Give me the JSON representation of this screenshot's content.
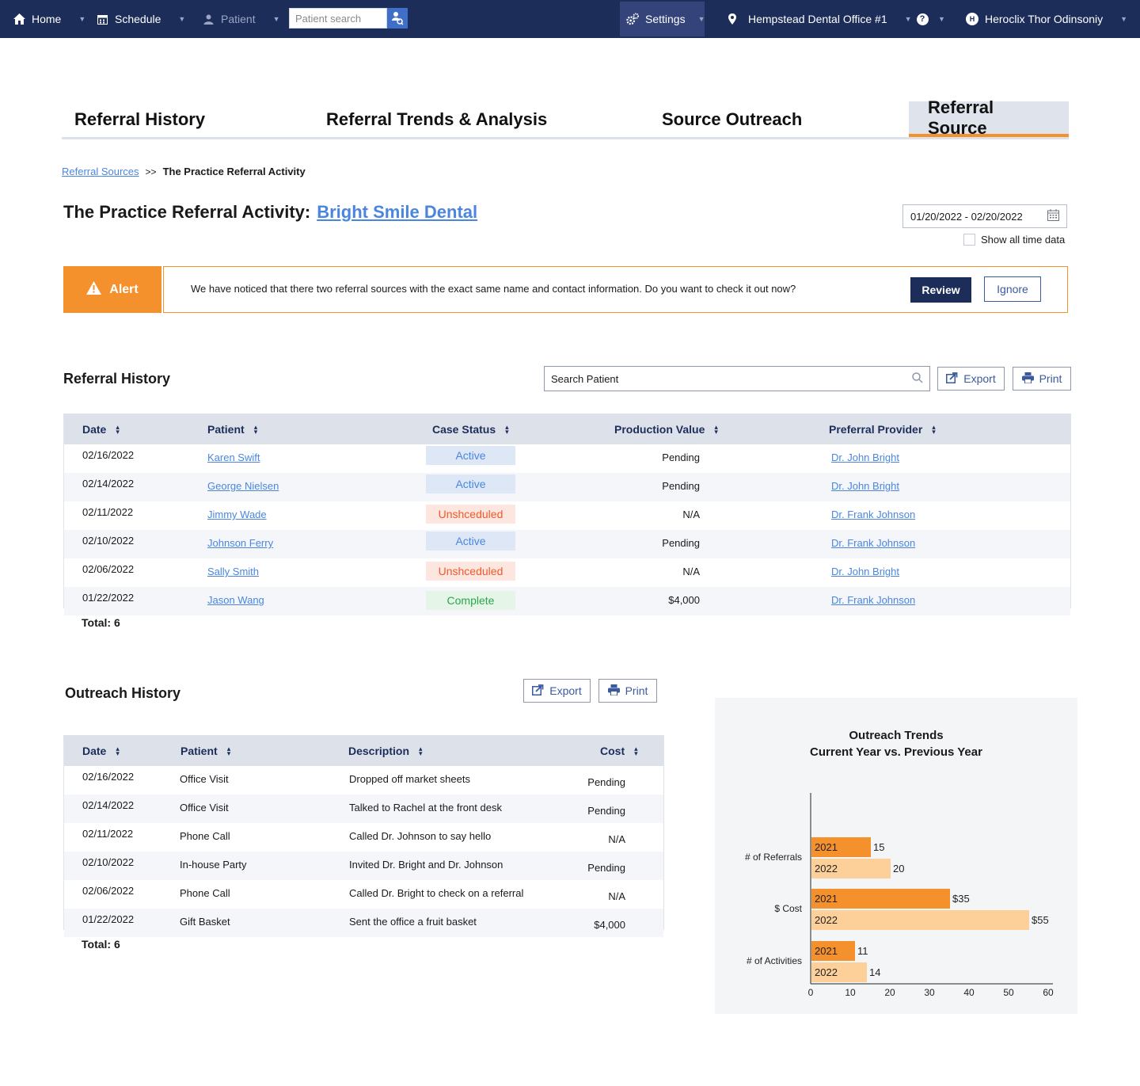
{
  "nav": {
    "home": "Home",
    "schedule": "Schedule",
    "patient": "Patient",
    "patient_search_placeholder": "Patient search",
    "settings": "Settings",
    "office": "Hempstead Dental Office #1",
    "help": "?",
    "avatar_initials": "H",
    "user": "Heroclix Thor Odinsoniy"
  },
  "tabs": [
    "Referral History",
    "Referral Trends & Analysis",
    "Source Outreach",
    "Referral Source"
  ],
  "breadcrumb": {
    "parent": "Referral Sources",
    "separator": ">>",
    "current": "The Practice Referral Activity"
  },
  "page": {
    "title_prefix": "The Practice Referral Activity:",
    "title_link": "Bright Smile Dental",
    "date_range": "01/20/2022 - 02/20/2022",
    "show_all_time": "Show all time data"
  },
  "alert": {
    "label": "Alert",
    "message": "We have noticed that there two referral sources with the exact same name and contact information. Do you want to check it out now?",
    "review": "Review",
    "ignore": "Ignore"
  },
  "referral_history": {
    "title": "Referral History",
    "search_placeholder": "Search Patient",
    "export": "Export",
    "print": "Print",
    "columns": [
      "Date",
      "Patient",
      "Case Status",
      "Production Value",
      "Preferral Provider"
    ],
    "rows": [
      {
        "date": "02/16/2022",
        "patient": "Karen Swift",
        "status": "Active",
        "status_type": "active",
        "value": "Pending",
        "provider": "Dr. John Bright"
      },
      {
        "date": "02/14/2022",
        "patient": "George Nielsen",
        "status": "Active",
        "status_type": "active",
        "value": "Pending",
        "provider": "Dr. John Bright"
      },
      {
        "date": "02/11/2022",
        "patient": "Jimmy Wade",
        "status": "Unshceduled",
        "status_type": "unsched",
        "value": "N/A",
        "provider": "Dr. Frank Johnson"
      },
      {
        "date": "02/10/2022",
        "patient": "Johnson Ferry",
        "status": "Active",
        "status_type": "active",
        "value": "Pending",
        "provider": "Dr. Frank Johnson"
      },
      {
        "date": "02/06/2022",
        "patient": "Sally Smith",
        "status": "Unshceduled",
        "status_type": "unsched",
        "value": "N/A",
        "provider": "Dr. John Bright"
      },
      {
        "date": "01/22/2022",
        "patient": "Jason Wang",
        "status": "Complete",
        "status_type": "complete",
        "value": "$4,000",
        "provider": "Dr. Frank Johnson"
      }
    ],
    "total": "Total: 6"
  },
  "outreach_history": {
    "title": "Outreach History",
    "export": "Export",
    "print": "Print",
    "columns": [
      "Date",
      "Patient",
      "Description",
      "Cost"
    ],
    "rows": [
      {
        "date": "02/16/2022",
        "patient": "Office Visit",
        "description": "Dropped off market sheets",
        "cost": "Pending"
      },
      {
        "date": "02/14/2022",
        "patient": "Office Visit",
        "description": "Talked to Rachel at the front desk",
        "cost": "Pending"
      },
      {
        "date": "02/11/2022",
        "patient": "Phone Call",
        "description": "Called Dr. Johnson to say hello",
        "cost": "N/A"
      },
      {
        "date": "02/10/2022",
        "patient": "In-house Party",
        "description": "Invited Dr. Bright and Dr. Johnson",
        "cost": "Pending"
      },
      {
        "date": "02/06/2022",
        "patient": "Phone Call",
        "description": "Called Dr. Bright to check on a referral",
        "cost": "N/A"
      },
      {
        "date": "01/22/2022",
        "patient": "Gift Basket",
        "description": "Sent the office a fruit basket",
        "cost": "$4,000"
      }
    ],
    "total": "Total: 6"
  },
  "colors": {
    "navy": "#1c2d5a",
    "accent_orange": "#f5912c",
    "light_orange": "#fdd09a",
    "link_blue": "#4a86e0"
  },
  "chart_data": {
    "type": "bar",
    "orientation": "horizontal",
    "title": "Outreach Trends",
    "subtitle": "Current Year vs. Previous Year",
    "categories": [
      "# of Referrals",
      "$ Cost",
      "# of Activities"
    ],
    "series": [
      {
        "name": "2021",
        "values": [
          15,
          35,
          11
        ],
        "labels": [
          "15",
          "$35",
          "11"
        ],
        "color": "#f5912c"
      },
      {
        "name": "2022",
        "values": [
          20,
          55,
          14
        ],
        "labels": [
          "20",
          "$55",
          "14"
        ],
        "color": "#fdd09a"
      }
    ],
    "xlim": [
      0,
      60
    ],
    "xticks": [
      0,
      10,
      20,
      30,
      40,
      50,
      60
    ],
    "grid": false,
    "legend": "none"
  }
}
